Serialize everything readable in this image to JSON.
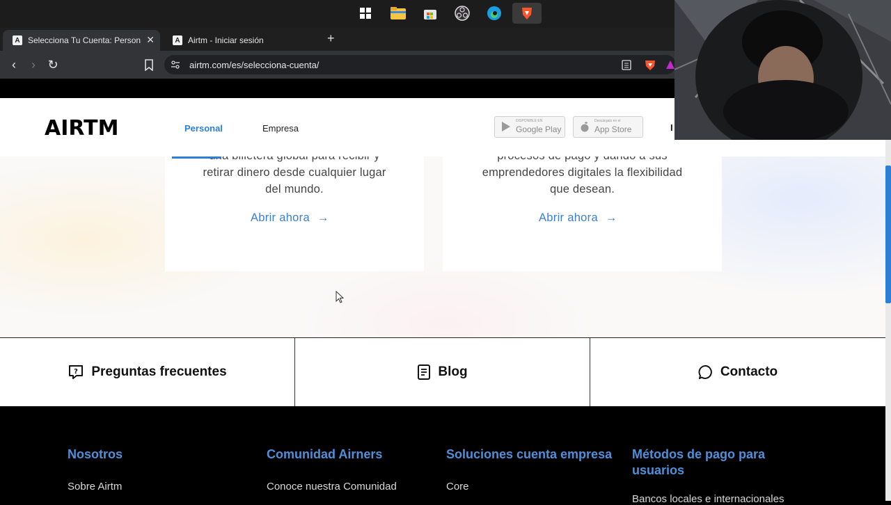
{
  "browser": {
    "tabs": [
      {
        "title": "Selecciona Tu Cuenta: Personal o",
        "active": true
      },
      {
        "title": "Airtm - Iniciar sesión",
        "active": false
      }
    ],
    "url": "airtm.com/es/selecciona-cuenta/"
  },
  "header": {
    "logo": "AIRTM",
    "nav": [
      {
        "label": "Personal",
        "active": true
      },
      {
        "label": "Empresa",
        "active": false
      }
    ],
    "badges": {
      "google": {
        "small": "DISPONIBLE EN",
        "big": "Google Play"
      },
      "apple": {
        "small": "Descárgalo en el",
        "big": "App Store"
      }
    },
    "cut_text": "I"
  },
  "cards": [
    {
      "text_lines": [
        "una billetera global para recibir y",
        "retirar dinero desde cualquier lugar",
        "del mundo."
      ],
      "link": "Abrir ahora"
    },
    {
      "text_lines": [
        "procesos de pago y dando a sus",
        "emprendedores digitales la flexibilidad",
        "que desean."
      ],
      "link": "Abrir ahora"
    }
  ],
  "resources": [
    {
      "label": "Preguntas frecuentes",
      "icon": "faq-icon"
    },
    {
      "label": "Blog",
      "icon": "blog-icon"
    },
    {
      "label": "Contacto",
      "icon": "chat-icon"
    }
  ],
  "footer": {
    "columns": [
      {
        "heading": "Nosotros",
        "first_item": "Sobre Airtm"
      },
      {
        "heading": "Comunidad Airners",
        "first_item": "Conoce nuestra Comunidad"
      },
      {
        "heading": "Soluciones cuenta empresa",
        "first_item": "Core"
      },
      {
        "heading": "Métodos de pago para usuarios",
        "first_item": "Bancos locales e internacionales"
      }
    ]
  },
  "colors": {
    "accent": "#2d7fd6",
    "link": "#3b7fd0",
    "footer_heading": "#4f90da"
  }
}
